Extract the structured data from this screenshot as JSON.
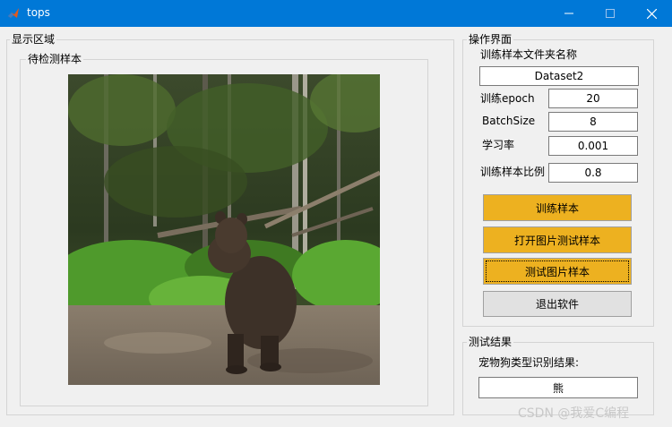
{
  "window": {
    "title": "tops",
    "minimize": "—",
    "maximize": "☐",
    "close": "✕"
  },
  "display_area": {
    "title": "显示区域",
    "sample_panel": {
      "title": "待检测样本",
      "image_alt": "brown bear walking into forest"
    }
  },
  "operation": {
    "title": "操作界面",
    "folder_label": "训练样本文件夹名称",
    "folder_value": "Dataset2",
    "epoch_label": "训练epoch",
    "epoch_value": "20",
    "batch_label": "BatchSize",
    "batch_value": "8",
    "lr_label": "学习率",
    "lr_value": "0.001",
    "ratio_label": "训练样本比例",
    "ratio_value": "0.8",
    "buttons": {
      "train": "训练样本",
      "open_image": "打开图片测试样本",
      "test_image": "测试图片样本",
      "exit": "退出软件"
    }
  },
  "result": {
    "title": "测试结果",
    "label": "宠物狗类型识别结果:",
    "value": "熊"
  },
  "watermark": "CSDN @我爱C编程",
  "colors": {
    "titlebar": "#0078d7",
    "button_orange": "#edb120",
    "background": "#f0f0f0"
  }
}
